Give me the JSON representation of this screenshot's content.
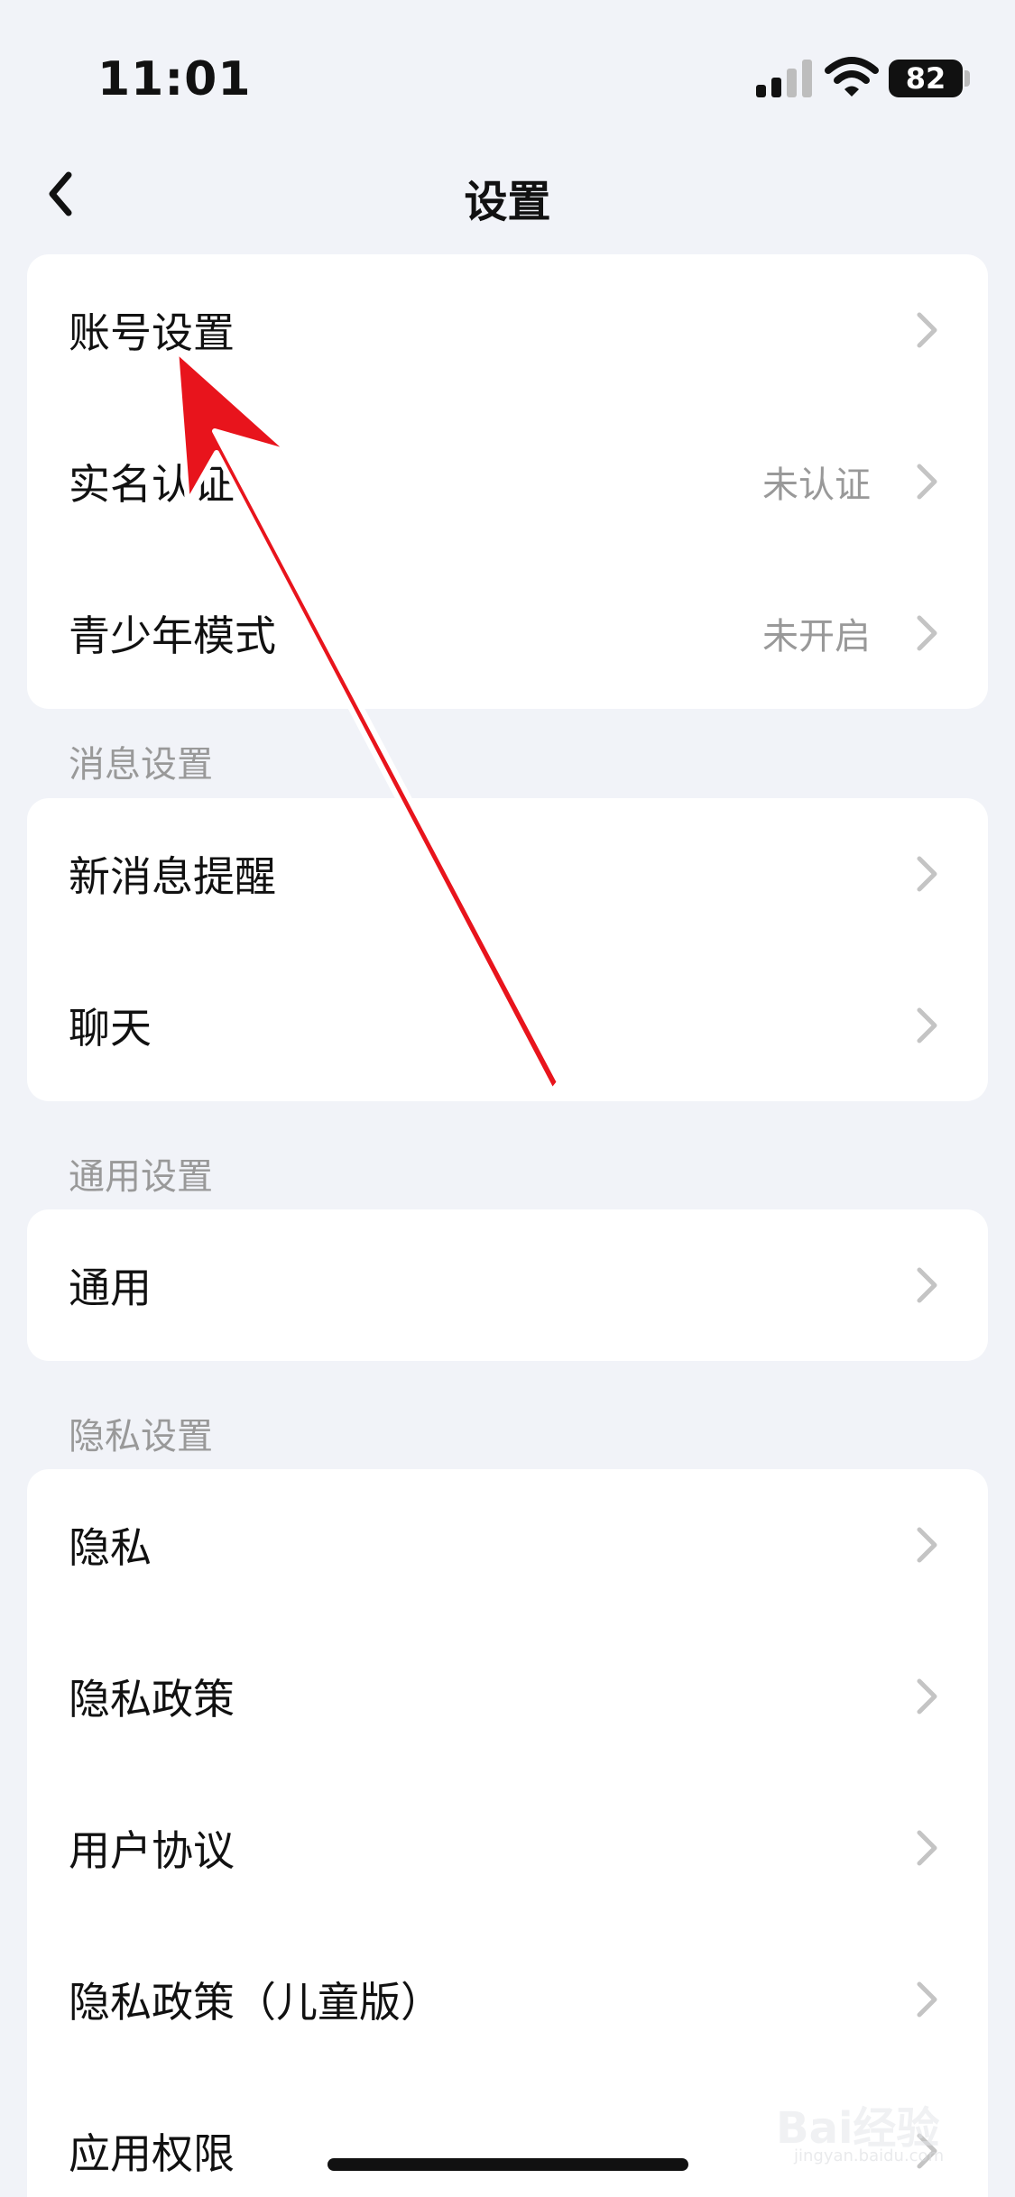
{
  "status_bar": {
    "time": "11:01",
    "battery": "82",
    "signal_icon": "cellular-signal-icon",
    "wifi_icon": "wifi-icon"
  },
  "nav": {
    "title": "设置",
    "back_icon": "chevron-left-icon"
  },
  "account_section": {
    "rows": [
      {
        "label": "账号设置",
        "value": ""
      },
      {
        "label": "实名认证",
        "value": "未认证"
      },
      {
        "label": "青少年模式",
        "value": "未开启"
      }
    ]
  },
  "message_section": {
    "header": "消息设置",
    "rows": [
      {
        "label": "新消息提醒",
        "value": ""
      },
      {
        "label": "聊天",
        "value": ""
      }
    ]
  },
  "general_section": {
    "header": "通用设置",
    "rows": [
      {
        "label": "通用",
        "value": ""
      }
    ]
  },
  "privacy_section": {
    "header": "隐私设置",
    "rows": [
      {
        "label": "隐私",
        "value": ""
      },
      {
        "label": "隐私政策",
        "value": ""
      },
      {
        "label": "用户协议",
        "value": ""
      },
      {
        "label": "隐私政策（儿童版）",
        "value": ""
      },
      {
        "label": "应用权限",
        "value": ""
      }
    ]
  },
  "watermark": {
    "text": "Bai经验",
    "sub": "jingyan.baidu.com"
  },
  "colors": {
    "background": "#f1f3f8",
    "card": "#ffffff",
    "annotation_arrow": "#e8141c",
    "secondary_text": "#999999"
  }
}
